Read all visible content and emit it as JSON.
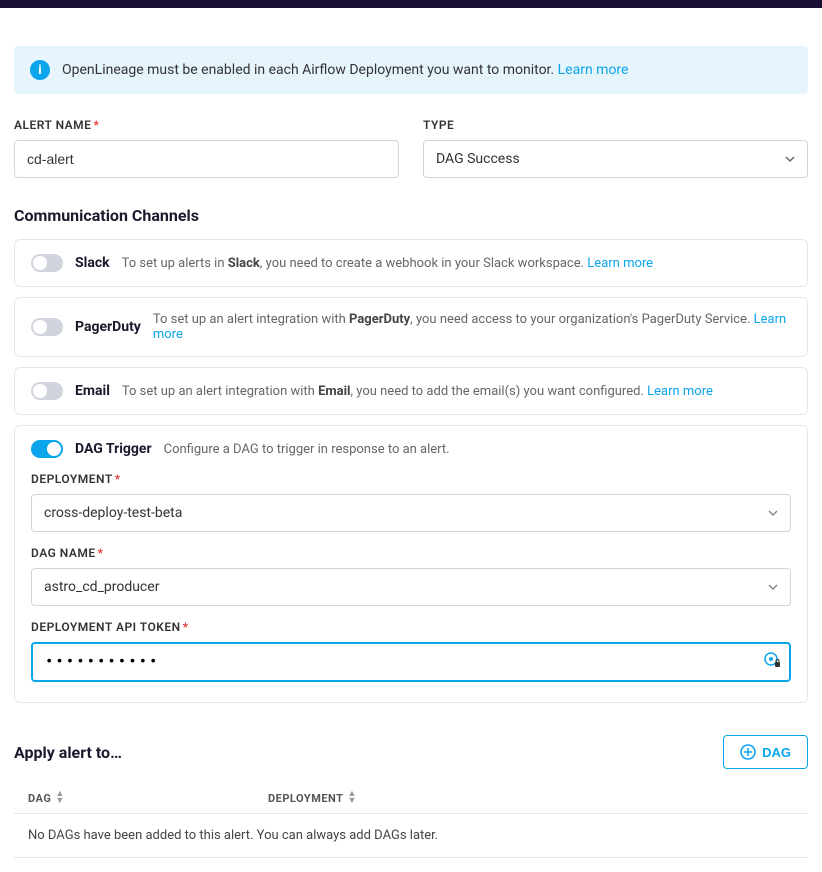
{
  "banner": {
    "text": "OpenLineage must be enabled in each Airflow Deployment you want to monitor.",
    "learn_more": "Learn more"
  },
  "form": {
    "alert_name_label": "ALERT NAME",
    "alert_name_value": "cd-alert",
    "type_label": "TYPE",
    "type_value": "DAG Success"
  },
  "comm": {
    "title": "Communication Channels",
    "slack": {
      "name": "Slack",
      "desc_pre": "To set up alerts in ",
      "desc_bold": "Slack",
      "desc_post": ", you need to create a webhook in your Slack workspace.",
      "learn": "Learn more"
    },
    "pagerduty": {
      "name": "PagerDuty",
      "desc_pre": "To set up an alert integration with ",
      "desc_bold": "PagerDuty",
      "desc_post": ", you need access to your organization's PagerDuty Service.",
      "learn": "Learn more"
    },
    "email": {
      "name": "Email",
      "desc_pre": "To set up an alert integration with ",
      "desc_bold": "Email",
      "desc_post": ", you need to add the email(s) you want configured.",
      "learn": "Learn more"
    },
    "dag_trigger": {
      "name": "DAG Trigger",
      "desc": "Configure a DAG to trigger in response to an alert.",
      "deployment_label": "DEPLOYMENT",
      "deployment_value": "cross-deploy-test-beta",
      "dag_name_label": "DAG NAME",
      "dag_name_value": "astro_cd_producer",
      "token_label": "DEPLOYMENT API TOKEN",
      "token_value": "•••••••••••"
    }
  },
  "apply": {
    "title": "Apply alert to…",
    "dag_button": "DAG",
    "col_dag": "DAG",
    "col_deployment": "DEPLOYMENT",
    "empty": "No DAGs have been added to this alert. You can always add DAGs later."
  }
}
